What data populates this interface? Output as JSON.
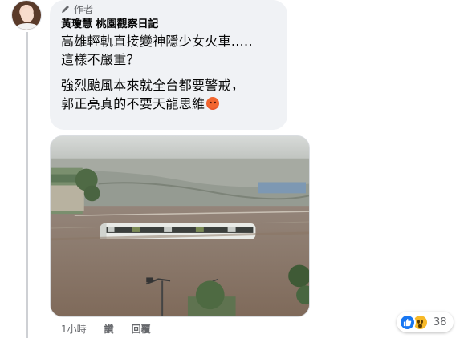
{
  "comment": {
    "author_badge": "作者",
    "author_name": "黃瓊慧 桃園觀察日記",
    "paragraph_1_line_1": "高雄輕軌直接變神隱少女火車.....",
    "paragraph_1_line_2": "這樣不嚴重？",
    "paragraph_2_line_1": "強烈颱風本來就全台都要警戒，",
    "paragraph_2_line_2": "郭正亮真的不要天龍思維",
    "emoji": "angry-emoji"
  },
  "footer": {
    "time": "1小時",
    "like_label": "讚",
    "reply_label": "回覆"
  },
  "reactions": {
    "types": [
      "like-icon",
      "wow-icon"
    ],
    "count": "38"
  },
  "colors": {
    "bubble_bg": "#f0f2f5",
    "like_blue": "#1877f2",
    "wow_yellow": "#f7b928",
    "muted_text": "#65676b"
  }
}
